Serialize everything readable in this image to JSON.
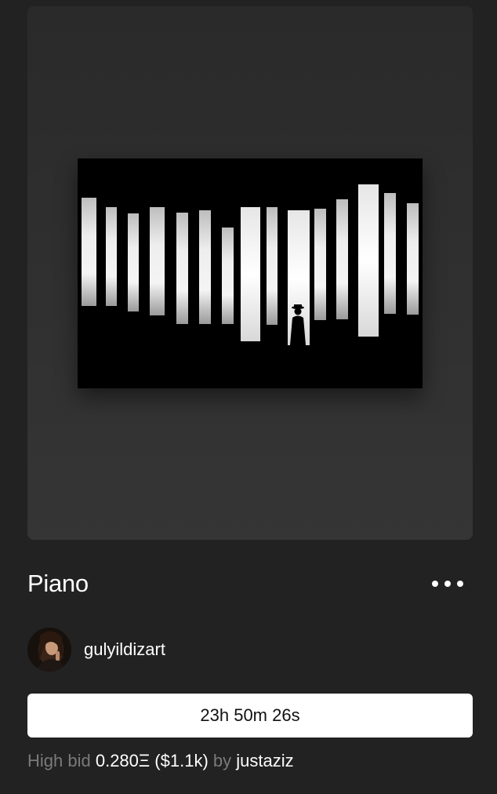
{
  "artwork": {
    "title": "Piano",
    "image_icon": "piano-keys-silhouette-artwork"
  },
  "menu": {
    "icon": "more-horizontal-icon"
  },
  "creator": {
    "username": "gulyildizart",
    "avatar_icon": "creator-avatar"
  },
  "auction": {
    "countdown": "23h 50m 26s",
    "high_bid_label": "High bid",
    "high_bid_amount": "0.280Ξ ($1.1k)",
    "by_label": "by",
    "bidder": "justaziz"
  },
  "colors": {
    "background": "#222222",
    "card": "#2f2f2f",
    "button_bg": "#ffffff",
    "muted_text": "#7a7a7a"
  }
}
